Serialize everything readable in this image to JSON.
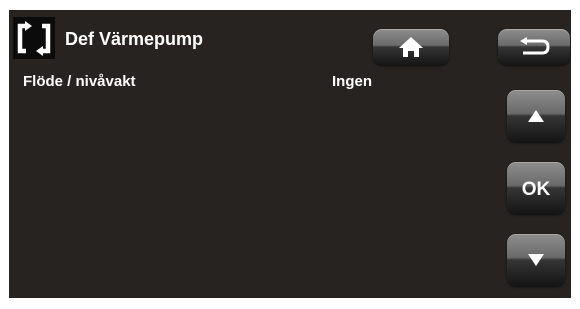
{
  "header": {
    "title": "Def Värmepump",
    "icon": "refresh-arrows-icon"
  },
  "rows": [
    {
      "label": "Flöde / nivåvakt",
      "value": "Ingen"
    }
  ],
  "buttons": {
    "home_icon": "home-icon",
    "back_icon": "back-arrow-icon",
    "up_icon": "up-triangle-icon",
    "ok_label": "OK",
    "down_icon": "down-triangle-icon"
  },
  "colors": {
    "screen_background": "#262320",
    "text": "#ffffff"
  }
}
